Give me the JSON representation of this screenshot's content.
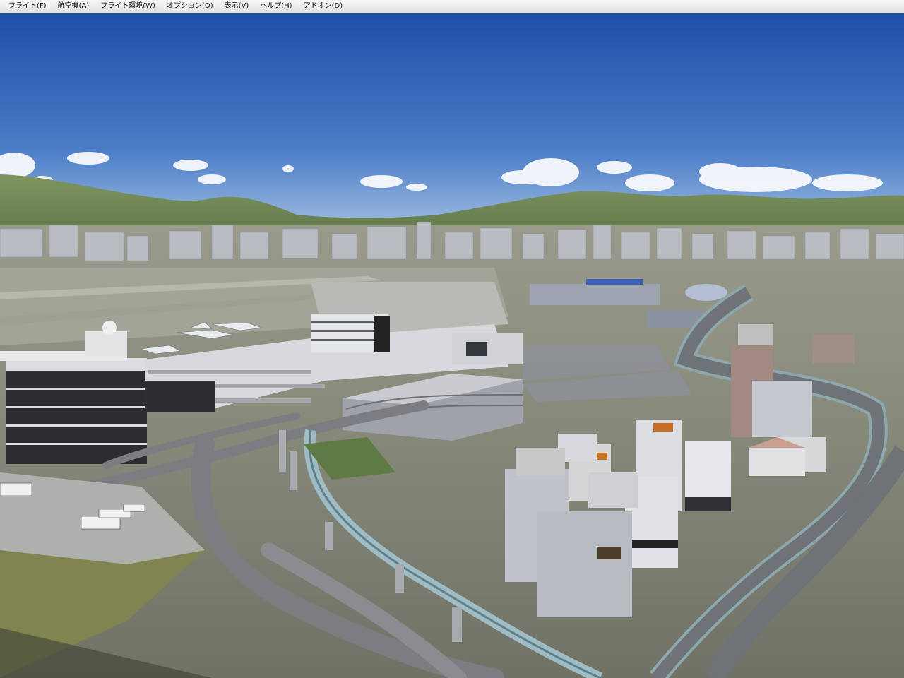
{
  "menubar": {
    "items": [
      {
        "label": "フライト(F)"
      },
      {
        "label": "航空機(A)"
      },
      {
        "label": "フライト環境(W)"
      },
      {
        "label": "オプション(O)"
      },
      {
        "label": "表示(V)"
      },
      {
        "label": "ヘルプ(H)"
      },
      {
        "label": "アドオン(D)"
      }
    ]
  },
  "scene": {
    "sky_top_color": "#1e4fa8",
    "sky_horizon_color": "#a9c4e4",
    "mountain_color": "#6f8a52",
    "ground_color": "#8d8f7e",
    "road_color": "#7b7d80"
  }
}
